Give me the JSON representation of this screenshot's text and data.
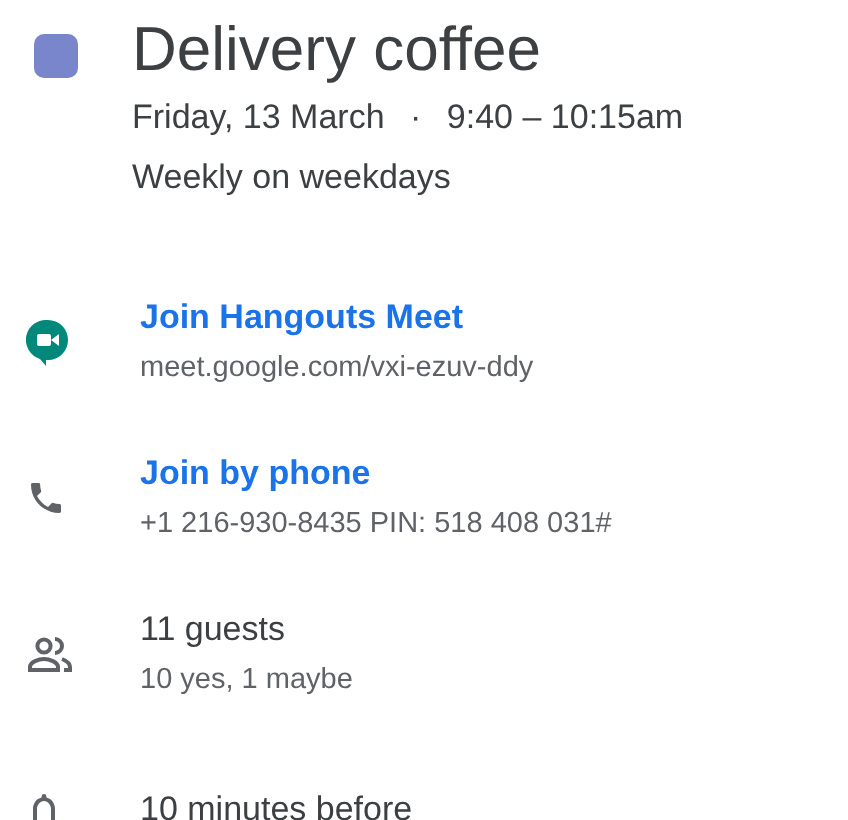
{
  "event": {
    "title": "Delivery coffee",
    "color": "#7986cb",
    "date": "Friday, 13 March",
    "separator": "·",
    "time": "9:40 – 10:15am",
    "recurrence": "Weekly on weekdays"
  },
  "items": [
    {
      "kind": "video",
      "primary": "Join Hangouts Meet",
      "link": true,
      "secondary": "meet.google.com/vxi-ezuv-ddy"
    },
    {
      "kind": "phone",
      "primary": "Join by phone",
      "link": true,
      "secondary": "+1 216-930-8435 PIN: 518 408 031#"
    },
    {
      "kind": "guests",
      "primary": "11 guests",
      "link": false,
      "secondary": "10 yes, 1 maybe"
    },
    {
      "kind": "reminder",
      "primary": "10 minutes before",
      "link": false
    }
  ]
}
